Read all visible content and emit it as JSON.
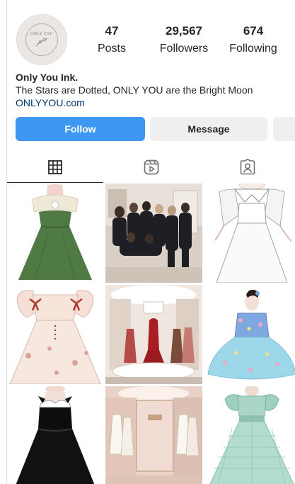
{
  "profile": {
    "avatar_text": "ONLY YOU",
    "stats": {
      "posts_count": "47",
      "posts_label": "Posts",
      "followers_count": "29,567",
      "followers_label": "Followers",
      "following_count": "674",
      "following_label": "Following"
    },
    "name": "Only You Ink.",
    "bio": "The Stars are Dotted, ONLY YOU are the Bright Moon",
    "website": "ONLYYOU.com"
  },
  "actions": {
    "follow_label": "Follow",
    "message_label": "Message"
  },
  "tabs": [
    {
      "icon": "grid-icon",
      "active": true
    },
    {
      "icon": "reels-icon",
      "active": false
    },
    {
      "icon": "tagged-icon",
      "active": false
    }
  ],
  "posts": [
    {
      "subject": "green strapless dress sketch"
    },
    {
      "subject": "team group photo"
    },
    {
      "subject": "white dress with collar sketch"
    },
    {
      "subject": "floral dress with red bows sketch"
    },
    {
      "subject": "boutique interior with red gowns"
    },
    {
      "subject": "blue floral ball gown sketch"
    },
    {
      "subject": "black velvet dress sketch"
    },
    {
      "subject": "store interior with white dresses"
    },
    {
      "subject": "mint green puff sleeve gown sketch"
    }
  ],
  "colors": {
    "follow_button": "#3e97f0",
    "secondary_button": "#efefef",
    "link": "#00376b",
    "text": "#262626",
    "divider": "#dbdbdb"
  }
}
